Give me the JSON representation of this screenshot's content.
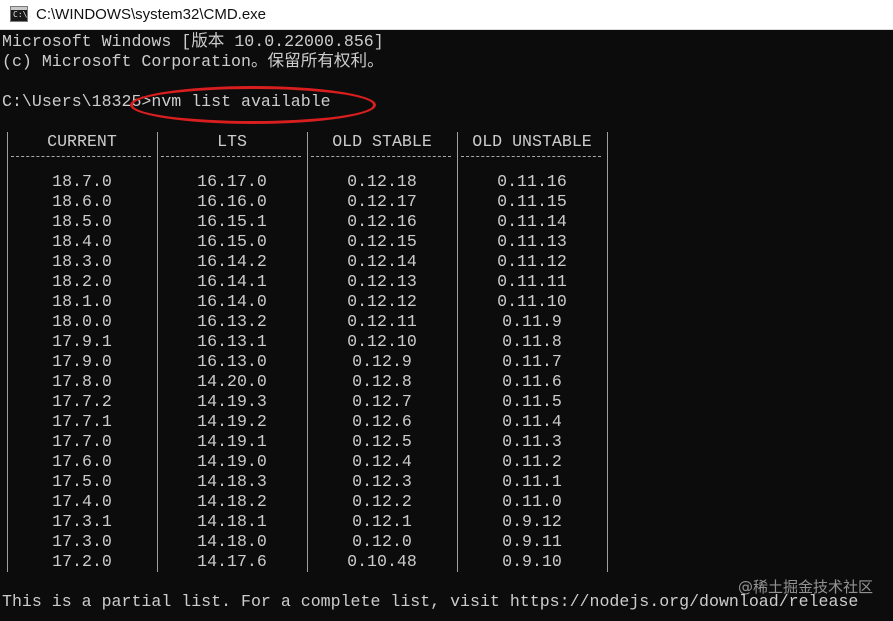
{
  "window": {
    "title": "C:\\WINDOWS\\system32\\CMD.exe",
    "icon": "cmd-app-icon",
    "icon_text": "C:\\."
  },
  "console": {
    "banner_line1": "Microsoft Windows [版本 10.0.22000.856]",
    "banner_line2": "(c) Microsoft Corporation。保留所有权利。",
    "prompt": "C:\\Users\\18325>",
    "command": "nvm list available",
    "footer": "This is a partial list. For a complete list, visit https://nodejs.org/download/release"
  },
  "table": {
    "headers": [
      "CURRENT",
      "LTS",
      "OLD STABLE",
      "OLD UNSTABLE"
    ],
    "rows": [
      [
        "18.7.0",
        "16.17.0",
        "0.12.18",
        "0.11.16"
      ],
      [
        "18.6.0",
        "16.16.0",
        "0.12.17",
        "0.11.15"
      ],
      [
        "18.5.0",
        "16.15.1",
        "0.12.16",
        "0.11.14"
      ],
      [
        "18.4.0",
        "16.15.0",
        "0.12.15",
        "0.11.13"
      ],
      [
        "18.3.0",
        "16.14.2",
        "0.12.14",
        "0.11.12"
      ],
      [
        "18.2.0",
        "16.14.1",
        "0.12.13",
        "0.11.11"
      ],
      [
        "18.1.0",
        "16.14.0",
        "0.12.12",
        "0.11.10"
      ],
      [
        "18.0.0",
        "16.13.2",
        "0.12.11",
        "0.11.9"
      ],
      [
        "17.9.1",
        "16.13.1",
        "0.12.10",
        "0.11.8"
      ],
      [
        "17.9.0",
        "16.13.0",
        "0.12.9",
        "0.11.7"
      ],
      [
        "17.8.0",
        "14.20.0",
        "0.12.8",
        "0.11.6"
      ],
      [
        "17.7.2",
        "14.19.3",
        "0.12.7",
        "0.11.5"
      ],
      [
        "17.7.1",
        "14.19.2",
        "0.12.6",
        "0.11.4"
      ],
      [
        "17.7.0",
        "14.19.1",
        "0.12.5",
        "0.11.3"
      ],
      [
        "17.6.0",
        "14.19.0",
        "0.12.4",
        "0.11.2"
      ],
      [
        "17.5.0",
        "14.18.3",
        "0.12.3",
        "0.11.1"
      ],
      [
        "17.4.0",
        "14.18.2",
        "0.12.2",
        "0.11.0"
      ],
      [
        "17.3.1",
        "14.18.1",
        "0.12.1",
        "0.9.12"
      ],
      [
        "17.3.0",
        "14.18.0",
        "0.12.0",
        "0.9.11"
      ],
      [
        "17.2.0",
        "14.17.6",
        "0.10.48",
        "0.9.10"
      ]
    ]
  },
  "annotation": {
    "color": "#d81e1e"
  },
  "watermark": "@稀土掘金技术社区",
  "colors": {
    "console_bg": "#0c0c0c",
    "console_text": "#cccccc",
    "titlebar_bg": "#ffffff"
  }
}
